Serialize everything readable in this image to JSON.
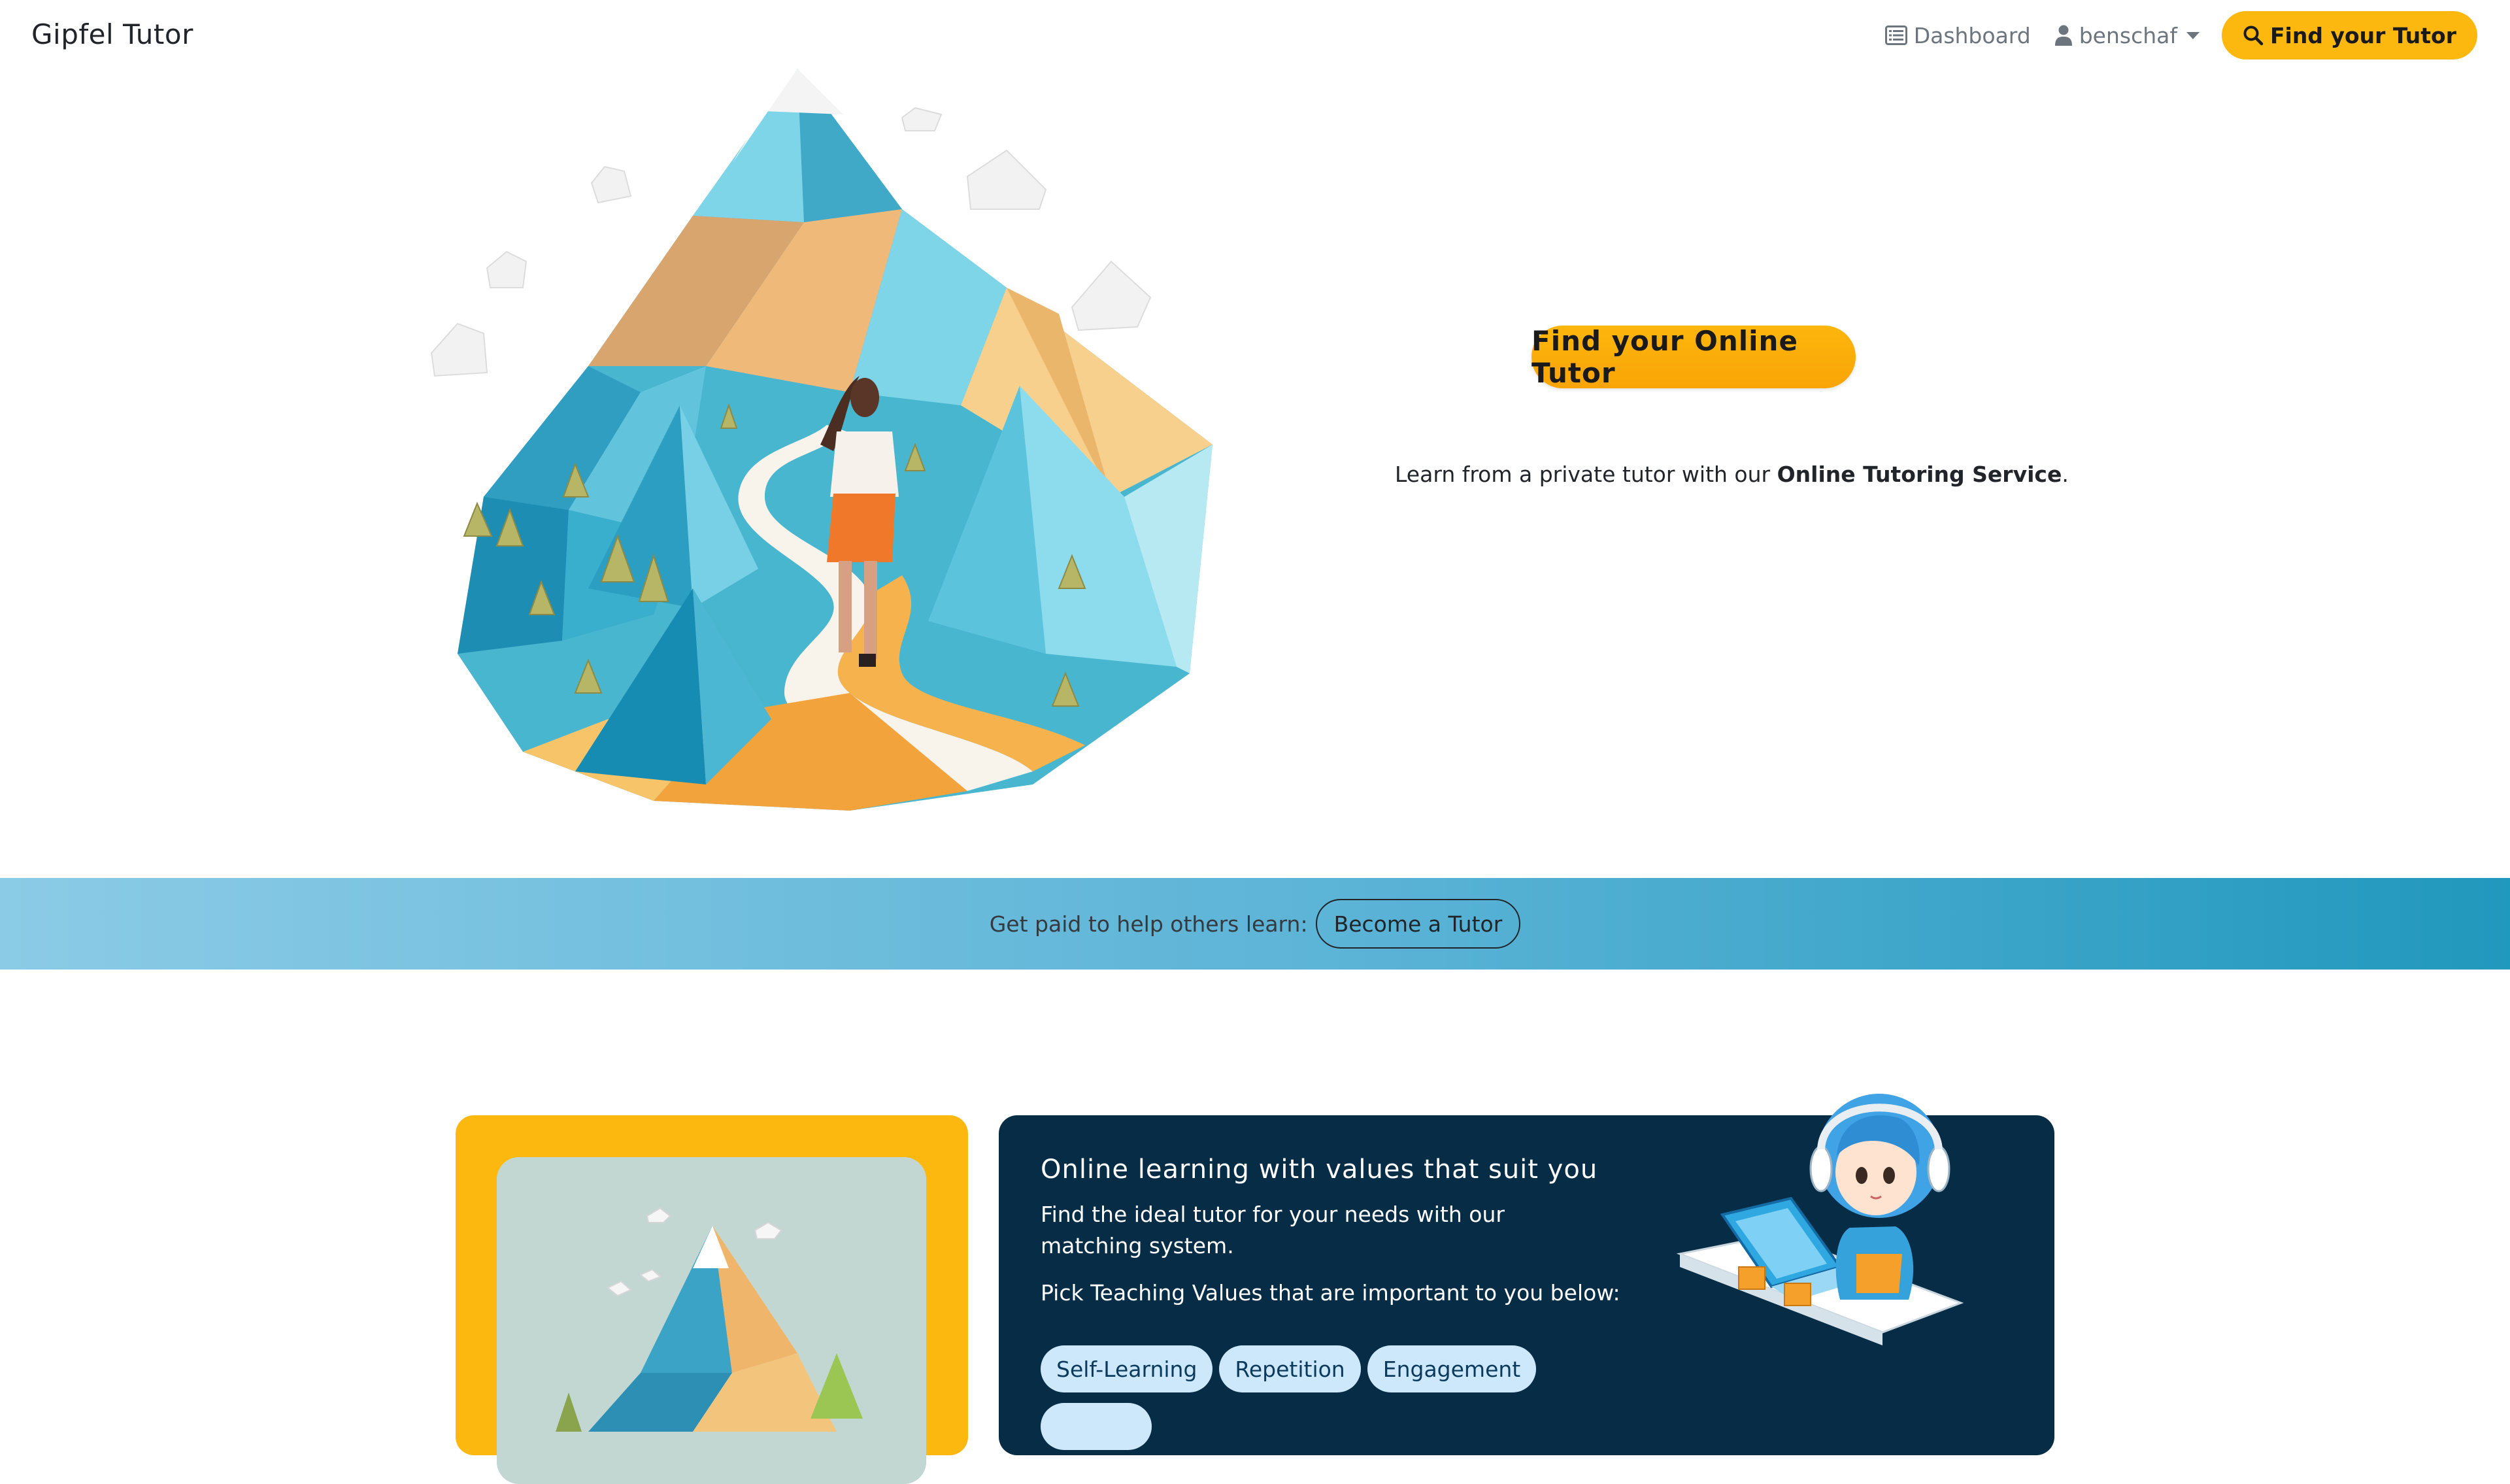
{
  "navbar": {
    "brand": "Gipfel Tutor",
    "dashboard_label": "Dashboard",
    "user_label": "benschaf",
    "find_button_label": "Find your Tutor"
  },
  "hero": {
    "cta_label": "Find your Online Tutor",
    "subtitle_prefix": "Learn from a private tutor with our ",
    "subtitle_bold": "Online Tutoring Service",
    "subtitle_suffix": "."
  },
  "banner": {
    "text": "Get paid to help others learn:",
    "button_label": "Become a Tutor"
  },
  "values_card": {
    "title": "Online learning with values that suit you",
    "description": "Find the ideal tutor for your needs with our matching system.",
    "pick_text": "Pick Teaching Values that are important to you below:",
    "pills": [
      "Self-Learning",
      "Repetition",
      "Engagement"
    ]
  },
  "colors": {
    "accent_yellow": "#fcb80f",
    "dark_navy": "#062c46",
    "pill_bg": "#cde8fb",
    "banner_start": "#8bcbe6",
    "banner_end": "#2198bd"
  },
  "icons": {
    "dashboard": "list-alt-icon",
    "user": "user-icon",
    "search": "search-icon"
  }
}
